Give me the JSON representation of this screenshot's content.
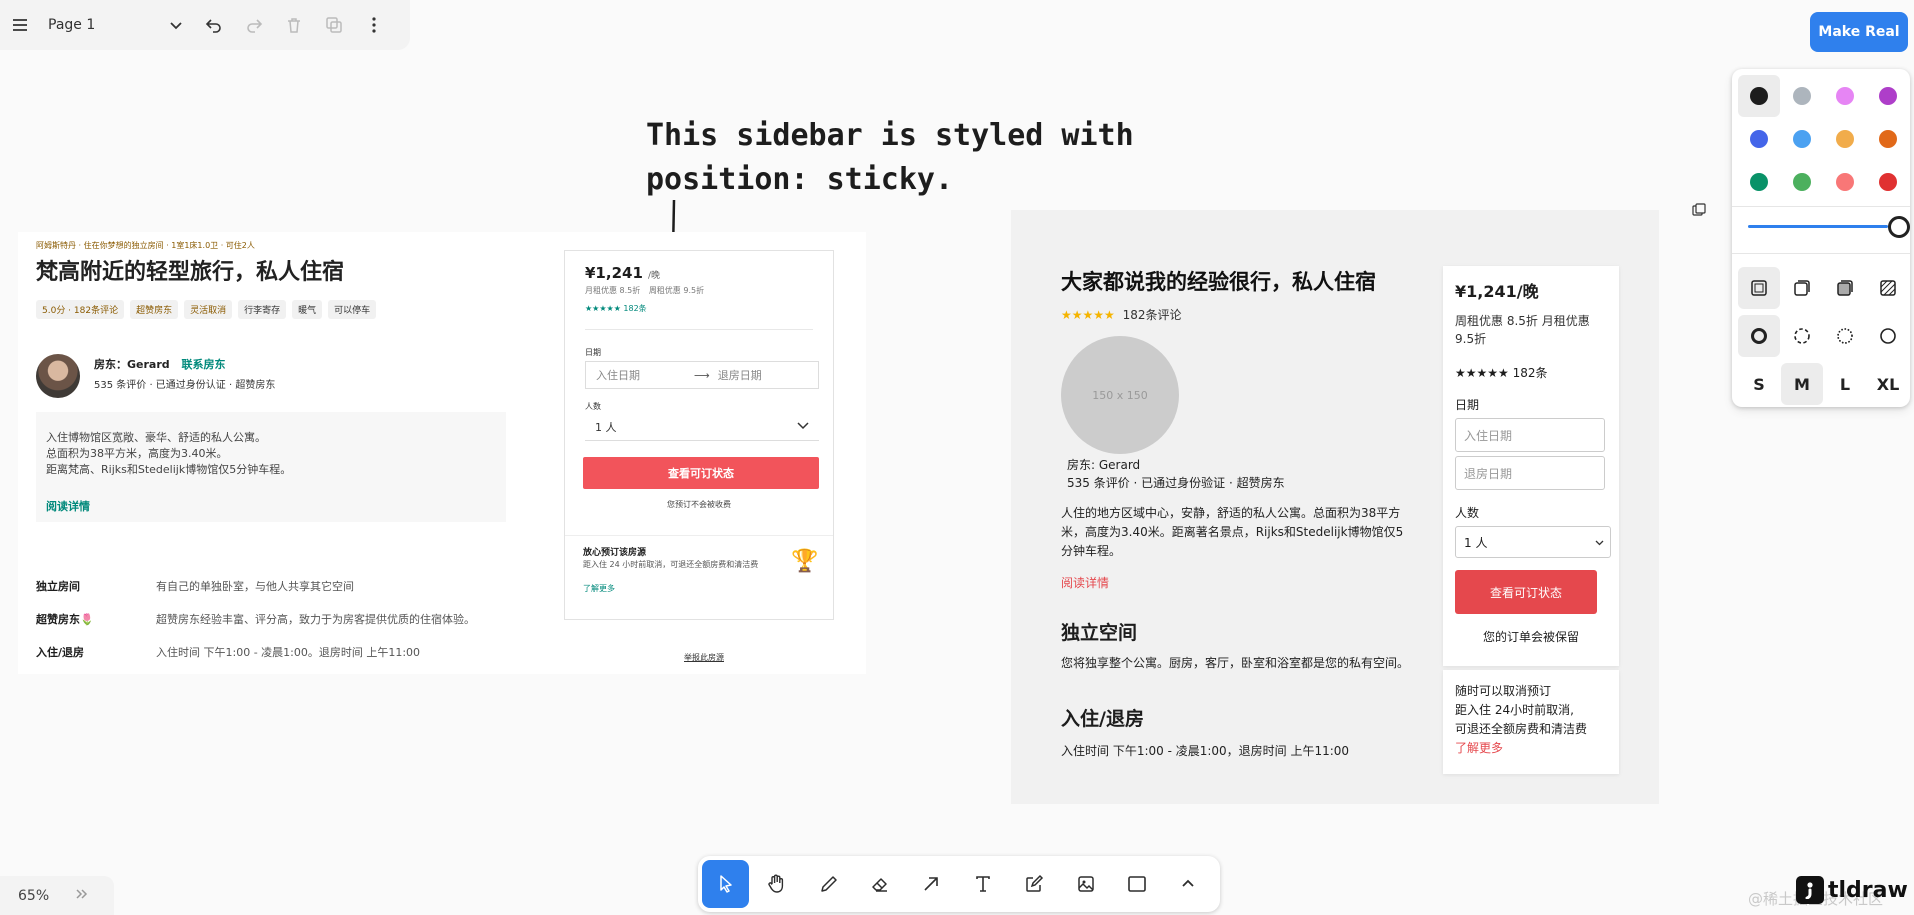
{
  "topbar": {
    "page_name": "Page 1"
  },
  "make_real_label": "Make Real",
  "annotation": {
    "line1": "This sidebar is styled with",
    "line2": "position: sticky."
  },
  "style_panel": {
    "colors": [
      "#1d1d1d",
      "#adb5bd",
      "#e685f4",
      "#ae3ec9",
      "#4465e9",
      "#4ba1f1",
      "#f1ac4b",
      "#e16919",
      "#099268",
      "#4cb05e",
      "#f87777",
      "#e03131"
    ],
    "selected_color": "black",
    "opacity": 100,
    "sizes": [
      "S",
      "M",
      "L",
      "XL"
    ],
    "selected_size": "M"
  },
  "mockup1": {
    "small_top": "阿姆斯特丹 · 住在你梦想的独立房间 · 1室1床1.0卫 · 可住2人",
    "title": "梵高附近的轻型旅行，私人住宿",
    "pills": [
      "5.0分 · 182条评论",
      "超赞房东",
      "灵活取消",
      "行李寄存",
      "暖气",
      "可以停车"
    ],
    "host_line": "房东：Gerard",
    "host_link": "联系房东",
    "host_sub": "535 条评价 · 已通过身份认证 · 超赞房东",
    "desc": [
      "入住博物馆区宽敞、豪华、舒适的私人公寓。",
      "总面积为38平方米，高度为3.40米。",
      "距离梵高、Rijks和Stedelijk博物馆仅5分钟车程。"
    ],
    "read_more": "阅读详情",
    "features": [
      {
        "k": "独立房间",
        "v": "有自己的单独卧室，与他人共享其它空间"
      },
      {
        "k": "超赞房东🌷",
        "v": "超赞房东经验丰富、评分高，致力于为房客提供优质的住宿体验。"
      },
      {
        "k": "入住/退房",
        "v": "入住时间 下午1:00 - 凌晨1:00。退房时间 上午11:00"
      }
    ],
    "card": {
      "price": "¥1,241",
      "per": "/晚",
      "discount1": "月租优惠 8.5折",
      "discount2": "周租优惠 9.5折",
      "rating": "★★★★★ 182条",
      "date_label": "日期",
      "checkin": "入住日期",
      "checkout": "退房日期",
      "guests_label": "人数",
      "guests": "1 人",
      "cta": "查看可订状态",
      "note": "您预订不会被收费",
      "assure_title": "放心预订该房源",
      "assure_text": "距入住 24 小时前取消，可退还全额房费和清洁费",
      "assure_link": "了解更多",
      "report": "举报此房源"
    }
  },
  "mockup2": {
    "title": "大家都说我的经验很行，私人住宿",
    "stars": "★★★★★",
    "reviews": "182条评论",
    "img_label": "150 x 150",
    "host": "房东: Gerard",
    "host_sub": "535 条评价 · 已通过身份验证 · 超赞房东",
    "desc": "人住的地方区域中心，安静，舒适的私人公寓。总面积为38平方米，高度为3.40米。距离著名景点，Rijks和Stedelijk博物馆仅5分钟车程。",
    "read_more": "阅读详情",
    "h_private": "独立空间",
    "private_text": "您将独享整个公寓。厨房，客厅，卧室和浴室都是您的私有空间。",
    "h_checkin": "入住/退房",
    "checkin_text": "入住时间 下午1:00 - 凌晨1:00，退房时间 上午11:00",
    "card": {
      "price": "¥1,241/晚",
      "discount": "周租优惠 8.5折 月租优惠 9.5折",
      "rating": "★★★★★ 182条",
      "date_label": "日期",
      "checkin_ph": "入住日期",
      "checkout_ph": "退房日期",
      "guests_label": "人数",
      "guests": "1 人",
      "cta": "查看可订状态",
      "note": "您的订单会被保留"
    },
    "card2": {
      "line1": "随时可以取消预订",
      "line2": "距入住 24小时前取消,",
      "line3": "可退还全额房费和清洁费",
      "link": "了解更多"
    }
  },
  "zoom": "65%",
  "watermark": "@稀土掘金技术社区",
  "logo": "tldraw"
}
